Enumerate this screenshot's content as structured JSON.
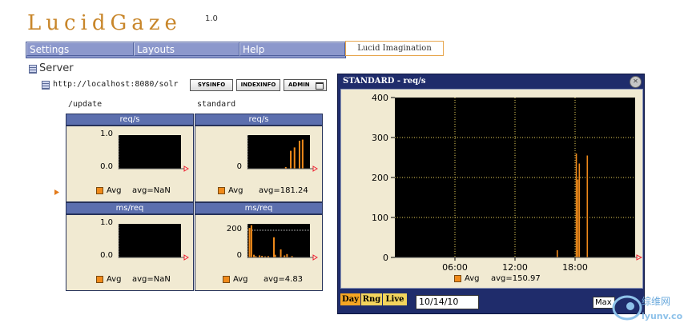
{
  "app": {
    "logo": "LucidGaze",
    "version": "1.0"
  },
  "menu": {
    "items": [
      "Settings",
      "Layouts",
      "Help"
    ],
    "brand": "Lucid Imagination"
  },
  "tree": {
    "server_label": "Server",
    "host": "http://localhost:8080/solr",
    "buttons": [
      "SYSINFO",
      "INDEXINFO",
      "ADMIN"
    ]
  },
  "columns": [
    "/update",
    "standard"
  ],
  "panels": [
    {
      "title": "req/s",
      "yticks": [
        "1.0",
        "0.0"
      ],
      "legend": "Avg",
      "avg": "avg=NaN"
    },
    {
      "title": "req/s",
      "yticks": [
        "0"
      ],
      "legend": "Avg",
      "avg": "avg=181.24"
    },
    {
      "title": "ms/req",
      "yticks": [
        "1.0",
        "0.0"
      ],
      "legend": "Avg",
      "avg": "avg=NaN"
    },
    {
      "title": "ms/req",
      "yticks": [
        "200",
        "0"
      ],
      "legend": "Avg",
      "avg": "avg=4.83"
    }
  ],
  "big_chart": {
    "title": "STANDARD - req/s",
    "legend": "Avg",
    "avg": "avg=150.97",
    "toolbar": [
      "Day",
      "Rng",
      "Live"
    ],
    "date": "10/14/10",
    "max_button": "Max"
  },
  "colors": {
    "accent": "#f08a1a",
    "window": "#1f2c6b",
    "panel_bg": "#f1ead2",
    "plot_bg": "#000000",
    "menu": "#8c98cc"
  },
  "chart_data": [
    {
      "type": "line",
      "title": "req/s",
      "series": [
        {
          "values": []
        }
      ],
      "yticks": [
        "1.0",
        "0.0"
      ],
      "legend": "Avg",
      "avg": "avg=NaN"
    },
    {
      "type": "bar",
      "title": "req/s",
      "yticks": [
        "0"
      ],
      "legend": "Avg",
      "avg": "avg=181.24",
      "x": [
        0.6,
        0.68,
        0.74,
        0.82,
        0.87
      ],
      "series": [
        {
          "name": "Avg",
          "values": [
            15,
            160,
            190,
            250,
            260
          ]
        }
      ],
      "ylim": [
        0,
        300
      ]
    },
    {
      "type": "line",
      "title": "ms/req",
      "series": [
        {
          "values": []
        }
      ],
      "yticks": [
        "1.0",
        "0.0"
      ],
      "legend": "Avg",
      "avg": "avg=NaN"
    },
    {
      "type": "bar",
      "title": "ms/req",
      "yticks": [
        "200",
        "0"
      ],
      "legend": "Avg",
      "avg": "avg=4.83",
      "ylim": [
        0,
        250
      ],
      "x": [
        0.02,
        0.05,
        0.09,
        0.12,
        0.18,
        0.22,
        0.27,
        0.32,
        0.41,
        0.43,
        0.52,
        0.58,
        0.62,
        0.7
      ],
      "series": [
        {
          "name": "Avg",
          "values": [
            220,
            240,
            20,
            10,
            15,
            12,
            8,
            10,
            150,
            20,
            60,
            15,
            25,
            10
          ]
        }
      ]
    },
    {
      "type": "bar",
      "title": "STANDARD - req/s",
      "xlabel": "",
      "ylabel": "",
      "xticks": [
        "06:00",
        "12:00",
        "18:00"
      ],
      "yticks": [
        0,
        100,
        200,
        300,
        400
      ],
      "ylim": [
        0,
        400
      ],
      "xlim_hours": [
        0,
        24
      ],
      "x_hours": [
        16.2,
        18.1,
        18.25,
        18.4,
        19.2
      ],
      "series": [
        {
          "name": "Avg",
          "values": [
            18,
            260,
            195,
            235,
            255
          ]
        }
      ],
      "legend": "Avg",
      "avg": "avg=150.97",
      "grid": true
    }
  ]
}
